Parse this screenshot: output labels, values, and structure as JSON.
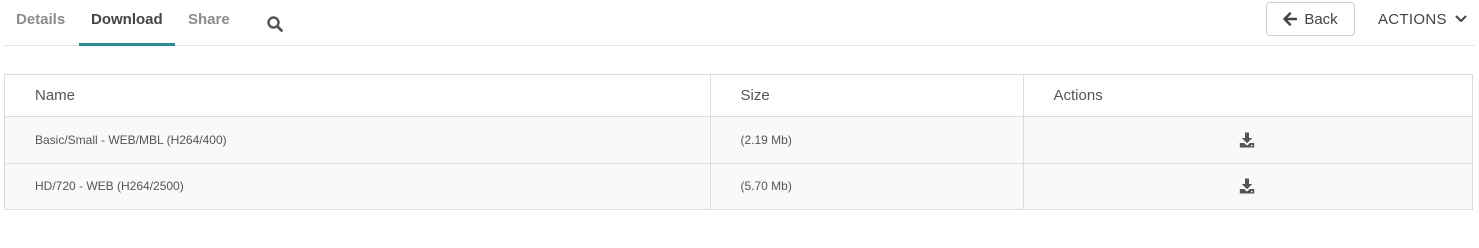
{
  "tabs": {
    "details": "Details",
    "download": "Download",
    "share": "Share"
  },
  "active_tab": "Download",
  "header": {
    "back_label": "Back",
    "actions_label": "ACTIONS"
  },
  "icons": {
    "search": "search-icon",
    "back": "arrow-left-icon",
    "actions": "chevron-down-icon",
    "download": "download-icon"
  },
  "colors": {
    "active_tab_underline": "#2a8a92",
    "icon": "#555555"
  },
  "table": {
    "headers": {
      "name": "Name",
      "size": "Size",
      "actions": "Actions"
    },
    "rows": [
      {
        "name": "Basic/Small - WEB/MBL (H264/400)",
        "size": "(2.19 Mb)"
      },
      {
        "name": "HD/720 - WEB (H264/2500)",
        "size": "(5.70 Mb)"
      }
    ]
  }
}
